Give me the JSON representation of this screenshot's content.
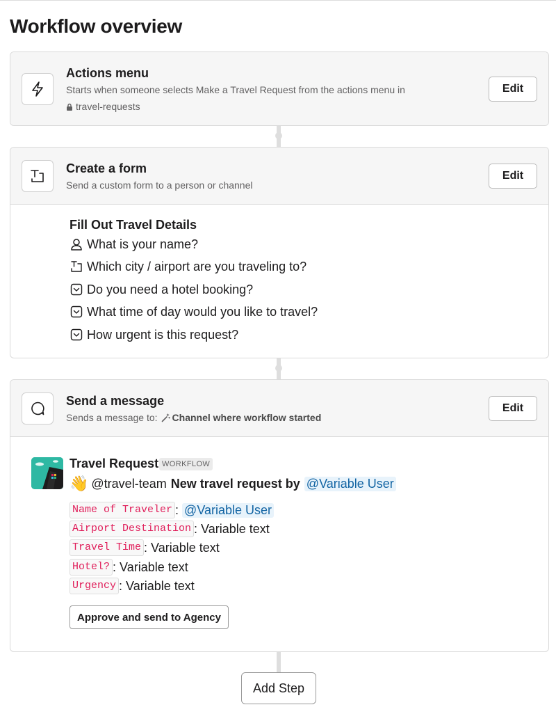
{
  "page": {
    "title": "Workflow overview"
  },
  "steps": [
    {
      "icon": "lightning-icon",
      "title": "Actions menu",
      "desc_line1": "Starts when someone selects Make a Travel Request from the actions menu in",
      "channel": "travel-requests",
      "channel_icon": "lock-icon",
      "edit_label": "Edit"
    },
    {
      "icon": "form-icon",
      "title": "Create a form",
      "desc": "Send a custom form to a person or channel",
      "edit_label": "Edit",
      "form": {
        "name": "Fill Out Travel Details",
        "fields": [
          {
            "icon": "person-icon",
            "label": "What is your name?"
          },
          {
            "icon": "text-field-icon",
            "label": "Which city / airport are you traveling to?"
          },
          {
            "icon": "dropdown-icon",
            "label": "Do you need a hotel booking?"
          },
          {
            "icon": "dropdown-icon",
            "label": "What time of day would you like to travel?"
          },
          {
            "icon": "dropdown-icon",
            "label": "How urgent is this request?"
          }
        ]
      }
    },
    {
      "icon": "message-bubble-icon",
      "title": "Send a message",
      "desc_prefix": "Sends a message to:",
      "desc_target": "Channel where workflow started",
      "target_icon": "magic-wand-icon",
      "edit_label": "Edit",
      "message": {
        "sender": "Travel Request",
        "badge": "WORKFLOW",
        "wave": "👋",
        "team_mention": "@travel-team",
        "headline": "New travel request by",
        "user_mention": "@Variable User",
        "fields": [
          {
            "key": "Name of Traveler",
            "sep": ": ",
            "value": "@Variable User",
            "is_mention": true
          },
          {
            "key": "Airport Destination",
            "sep": ": ",
            "value": "Variable text",
            "is_mention": false
          },
          {
            "key": "Travel Time",
            "sep": ": ",
            "value": "Variable text",
            "is_mention": false
          },
          {
            "key": "Hotel?",
            "sep": ": ",
            "value": "Variable text",
            "is_mention": false
          },
          {
            "key": "Urgency",
            "sep": ": ",
            "value": "Variable text",
            "is_mention": false
          }
        ],
        "button_label": "Approve and send to Agency"
      }
    }
  ],
  "add_step_label": "Add Step",
  "colors": {
    "accent_mention": "#1264a3",
    "mention_bg": "#e8f3fb",
    "code_text": "#e01e5a",
    "header_bg": "#f6f6f6",
    "avatar_bg": "#2eb8a3"
  }
}
